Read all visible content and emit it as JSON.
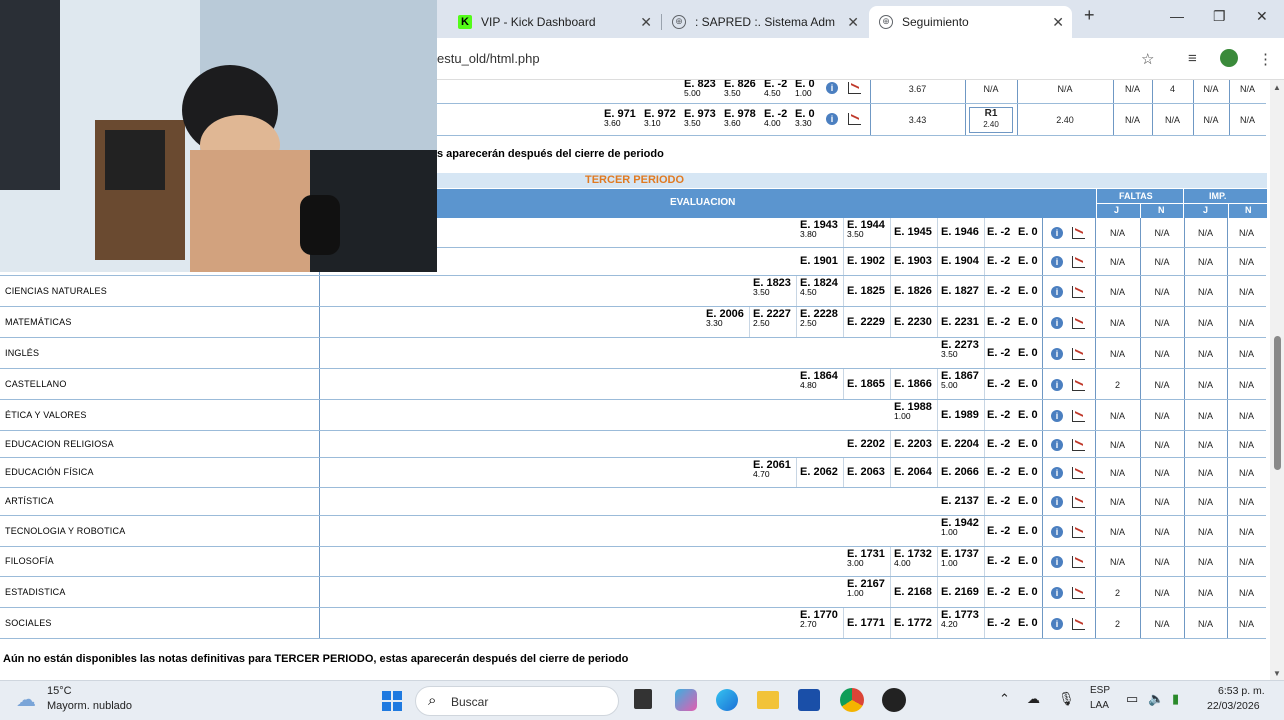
{
  "browser": {
    "tabs": [
      {
        "label": "VIP - Kick Dashboard",
        "color": "#53fc18",
        "letter": "K"
      },
      {
        "label": ": SAPRED :. Sistema Adminis",
        "color": "#5f6368",
        "letter": "⊕"
      },
      {
        "label": "Seguimiento",
        "color": "#5f6368",
        "letter": "⊕"
      }
    ],
    "new_tab": "+",
    "url": "estu_old/html.php",
    "controls": {
      "minimize": "—",
      "restore": "❐",
      "close": "✕"
    }
  },
  "prev_section": {
    "rows": [
      {
        "grades": [
          {
            "code": "E. 823",
            "val": "5.00"
          },
          {
            "code": "E. 826",
            "val": "3.50"
          },
          {
            "code": "E. -2",
            "val": "4.50"
          },
          {
            "code": "E. 0",
            "val": "1.00"
          }
        ],
        "def": "3.67",
        "rec": "N/A",
        "final": "N/A",
        "fj": "N/A",
        "fn": "4",
        "ij": "N/A",
        "in": "N/A"
      },
      {
        "grades": [
          {
            "code": "E. 971",
            "val": "3.60"
          },
          {
            "code": "E. 972",
            "val": "3.10"
          },
          {
            "code": "E. 973",
            "val": "3.50"
          },
          {
            "code": "E. 978",
            "val": "3.60"
          },
          {
            "code": "E. -2",
            "val": "4.00"
          },
          {
            "code": "E. 0",
            "val": "3.30"
          }
        ],
        "def": "3.43",
        "rec": "R1",
        "rec_val": "2.40",
        "final": "2.40",
        "fj": "N/A",
        "fn": "N/A",
        "ij": "N/A",
        "in": "N/A"
      }
    ],
    "notice": "s aparecerán después del cierre de periodo"
  },
  "period": {
    "title": "TERCER PERIODO",
    "eval_header": "EVALUACION",
    "faltas": "FALTAS",
    "imp": "IMP.",
    "j": "J",
    "n": "N"
  },
  "subjects": [
    {
      "name": "",
      "grades": [
        {
          "code": "E. 1943",
          "val": "3.80"
        },
        {
          "code": "E. 1944",
          "val": "3.50"
        },
        {
          "code": "E. 1945",
          "val": ""
        },
        {
          "code": "E. 1946",
          "val": ""
        },
        {
          "code": "E. -2",
          "val": ""
        },
        {
          "code": "E. 0",
          "val": ""
        }
      ],
      "fj": "N/A",
      "fn": "N/A",
      "ij": "N/A",
      "in": "N/A"
    },
    {
      "name": "",
      "grades": [
        {
          "code": "E. 1901",
          "val": ""
        },
        {
          "code": "E. 1902",
          "val": ""
        },
        {
          "code": "E. 1903",
          "val": ""
        },
        {
          "code": "E. 1904",
          "val": ""
        },
        {
          "code": "E. -2",
          "val": ""
        },
        {
          "code": "E. 0",
          "val": ""
        }
      ],
      "fj": "N/A",
      "fn": "N/A",
      "ij": "N/A",
      "in": "N/A"
    },
    {
      "name": "CIENCIAS NATURALES",
      "grades": [
        {
          "code": "E. 1823",
          "val": "3.50"
        },
        {
          "code": "E. 1824",
          "val": "4.50"
        },
        {
          "code": "E. 1825",
          "val": ""
        },
        {
          "code": "E. 1826",
          "val": ""
        },
        {
          "code": "E. 1827",
          "val": ""
        },
        {
          "code": "E. -2",
          "val": ""
        },
        {
          "code": "E. 0",
          "val": ""
        }
      ],
      "fj": "N/A",
      "fn": "N/A",
      "ij": "N/A",
      "in": "N/A"
    },
    {
      "name": "MATEMÁTICAS",
      "grades": [
        {
          "code": "E. 2006",
          "val": "3.30"
        },
        {
          "code": "E. 2227",
          "val": "2.50"
        },
        {
          "code": "E. 2228",
          "val": "2.50"
        },
        {
          "code": "E. 2229",
          "val": ""
        },
        {
          "code": "E. 2230",
          "val": ""
        },
        {
          "code": "E. 2231",
          "val": ""
        },
        {
          "code": "E. -2",
          "val": ""
        },
        {
          "code": "E. 0",
          "val": ""
        }
      ],
      "fj": "N/A",
      "fn": "N/A",
      "ij": "N/A",
      "in": "N/A"
    },
    {
      "name": "INGLÉS",
      "grades": [
        {
          "code": "E. 2273",
          "val": "3.50"
        },
        {
          "code": "E. -2",
          "val": ""
        },
        {
          "code": "E. 0",
          "val": ""
        }
      ],
      "fj": "N/A",
      "fn": "N/A",
      "ij": "N/A",
      "in": "N/A"
    },
    {
      "name": "CASTELLANO",
      "grades": [
        {
          "code": "E. 1864",
          "val": "4.80"
        },
        {
          "code": "E. 1865",
          "val": ""
        },
        {
          "code": "E. 1866",
          "val": ""
        },
        {
          "code": "E. 1867",
          "val": "5.00"
        },
        {
          "code": "E. -2",
          "val": ""
        },
        {
          "code": "E. 0",
          "val": ""
        }
      ],
      "fj": "2",
      "fn": "N/A",
      "ij": "N/A",
      "in": "N/A"
    },
    {
      "name": "ÉTICA Y VALORES",
      "grades": [
        {
          "code": "E. 1988",
          "val": "1.00"
        },
        {
          "code": "E. 1989",
          "val": ""
        },
        {
          "code": "E. -2",
          "val": ""
        },
        {
          "code": "E. 0",
          "val": ""
        }
      ],
      "fj": "N/A",
      "fn": "N/A",
      "ij": "N/A",
      "in": "N/A"
    },
    {
      "name": "EDUCACION RELIGIOSA",
      "grades": [
        {
          "code": "E. 2202",
          "val": ""
        },
        {
          "code": "E. 2203",
          "val": ""
        },
        {
          "code": "E. 2204",
          "val": ""
        },
        {
          "code": "E. -2",
          "val": ""
        },
        {
          "code": "E. 0",
          "val": ""
        }
      ],
      "fj": "N/A",
      "fn": "N/A",
      "ij": "N/A",
      "in": "N/A"
    },
    {
      "name": "EDUCACIÓN FÍSICA",
      "grades": [
        {
          "code": "E. 2061",
          "val": "4.70"
        },
        {
          "code": "E. 2062",
          "val": ""
        },
        {
          "code": "E. 2063",
          "val": ""
        },
        {
          "code": "E. 2064",
          "val": ""
        },
        {
          "code": "E. 2066",
          "val": ""
        },
        {
          "code": "E. -2",
          "val": ""
        },
        {
          "code": "E. 0",
          "val": ""
        }
      ],
      "fj": "N/A",
      "fn": "N/A",
      "ij": "N/A",
      "in": "N/A"
    },
    {
      "name": "ARTÍSTICA",
      "grades": [
        {
          "code": "E. 2137",
          "val": ""
        },
        {
          "code": "E. -2",
          "val": ""
        },
        {
          "code": "E. 0",
          "val": ""
        }
      ],
      "fj": "N/A",
      "fn": "N/A",
      "ij": "N/A",
      "in": "N/A"
    },
    {
      "name": "TECNOLOGIA Y ROBOTICA",
      "grades": [
        {
          "code": "E. 1942",
          "val": "1.00"
        },
        {
          "code": "E. -2",
          "val": ""
        },
        {
          "code": "E. 0",
          "val": ""
        }
      ],
      "fj": "N/A",
      "fn": "N/A",
      "ij": "N/A",
      "in": "N/A"
    },
    {
      "name": "FILOSOFÍA",
      "grades": [
        {
          "code": "E. 1731",
          "val": "3.00"
        },
        {
          "code": "E. 1732",
          "val": "4.00"
        },
        {
          "code": "E. 1737",
          "val": "1.00"
        },
        {
          "code": "E. -2",
          "val": ""
        },
        {
          "code": "E. 0",
          "val": ""
        }
      ],
      "fj": "N/A",
      "fn": "N/A",
      "ij": "N/A",
      "in": "N/A"
    },
    {
      "name": "ESTADISTICA",
      "grades": [
        {
          "code": "E. 2167",
          "val": "1.00"
        },
        {
          "code": "E. 2168",
          "val": ""
        },
        {
          "code": "E. 2169",
          "val": ""
        },
        {
          "code": "E. -2",
          "val": ""
        },
        {
          "code": "E. 0",
          "val": ""
        }
      ],
      "fj": "2",
      "fn": "N/A",
      "ij": "N/A",
      "in": "N/A"
    },
    {
      "name": "SOCIALES",
      "grades": [
        {
          "code": "E. 1770",
          "val": "2.70"
        },
        {
          "code": "E. 1771",
          "val": ""
        },
        {
          "code": "E. 1772",
          "val": ""
        },
        {
          "code": "E. 1773",
          "val": "4.20"
        },
        {
          "code": "E. -2",
          "val": ""
        },
        {
          "code": "E. 0",
          "val": ""
        }
      ],
      "fj": "2",
      "fn": "N/A",
      "ij": "N/A",
      "in": "N/A"
    }
  ],
  "footer_notice": "Aún no están disponibles las notas definitivas para TERCER PERIODO, estas aparecerán después del cierre de periodo",
  "taskbar": {
    "weather_temp": "15°C",
    "weather_desc": "Mayorm. nublado",
    "search": "Buscar",
    "lang": "ESP",
    "lang2": "LAA",
    "time": "6:53 p. m.",
    "date": "22/03/2026"
  }
}
